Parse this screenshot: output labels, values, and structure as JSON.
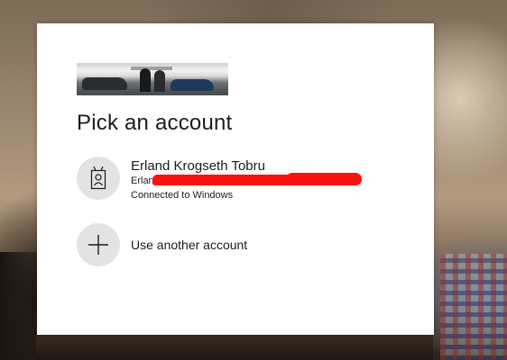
{
  "dialog": {
    "title": "Pick an account",
    "banner_image": "company-banner-image"
  },
  "accounts": [
    {
      "name": "Erland Krogseth Tobru",
      "email_visible": "Erland.",
      "email_at": "@",
      "status": "Connected to Windows",
      "icon": "id-badge-icon"
    }
  ],
  "other_account": {
    "label": "Use another account",
    "icon": "plus-icon"
  },
  "colors": {
    "dialog_bg": "#ffffff",
    "icon_circle_bg": "#e3e3e3",
    "text": "#1b1b1b",
    "redaction": "#ff1010"
  }
}
